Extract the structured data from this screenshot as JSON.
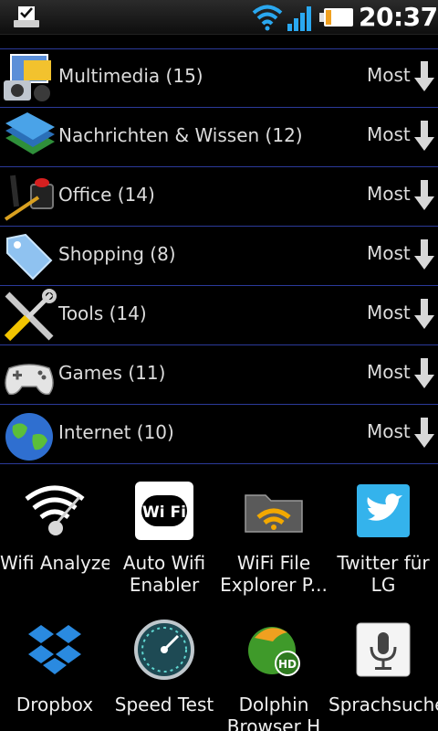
{
  "status_bar": {
    "time": "20:37",
    "icons": [
      "notification-check-icon",
      "wifi-icon",
      "signal-icon",
      "battery-icon"
    ]
  },
  "categories": [
    {
      "name": "Multimedia (15)",
      "sort": "Most",
      "icon": "multimedia-icon"
    },
    {
      "name": "Nachrichten & Wissen  (12)",
      "sort": "Most",
      "icon": "books-icon"
    },
    {
      "name": "Office (14)",
      "sort": "Most",
      "icon": "office-icon"
    },
    {
      "name": "Shopping  (8)",
      "sort": "Most",
      "icon": "tag-icon"
    },
    {
      "name": "Tools (14)",
      "sort": "Most",
      "icon": "tools-icon"
    },
    {
      "name": "Games (11)",
      "sort": "Most",
      "icon": "gamepad-icon"
    },
    {
      "name": "Internet (10)",
      "sort": "Most",
      "icon": "globe-icon"
    }
  ],
  "apps": [
    {
      "label": "Wifi Analyzer",
      "icon": "wifi-analyzer-icon"
    },
    {
      "label": "Auto Wifi Enabler",
      "icon": "wifi-badge-icon"
    },
    {
      "label": "WiFi File Explorer P...",
      "icon": "wifi-folder-icon"
    },
    {
      "label": "Twitter für LG",
      "icon": "twitter-bird-icon"
    },
    {
      "label": "Dropbox",
      "icon": "dropbox-icon"
    },
    {
      "label": "Speed Test",
      "icon": "speedometer-icon"
    },
    {
      "label": "Dolphin Browser H",
      "icon": "dolphin-icon"
    },
    {
      "label": "Sprachsuche",
      "icon": "microphone-icon"
    }
  ],
  "colors": {
    "divider": "#2b3a9a",
    "wifi_blue": "#2aa8f0",
    "battery_white": "#ffffff"
  }
}
